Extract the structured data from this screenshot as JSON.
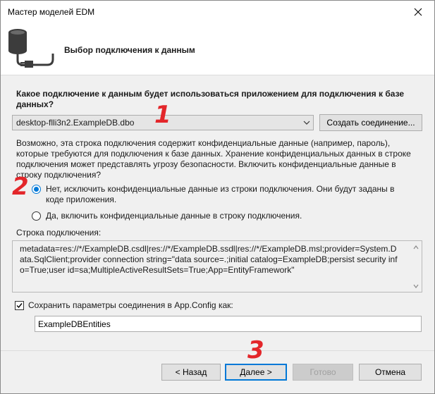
{
  "window": {
    "title": "Мастер моделей EDM"
  },
  "header": {
    "title": "Выбор подключения к данным",
    "icon": "database-plug-icon"
  },
  "question": "Какое подключение к данным будет использоваться приложением для подключения к базе данных?",
  "connection_select": {
    "value": "desktop-flli3n2.ExampleDB.dbo"
  },
  "create_connection_button": "Создать соединение...",
  "warning_text": "Возможно, эта строка подключения содержит конфиденциальные данные (например, пароль), которые требуются для подключения к базе данных. Хранение конфиденциальных данных в строке подключения может представлять угрозу безопасности. Включить конфиденциальные данные в строку подключения?",
  "radio_options": [
    {
      "label": "Нет, исключить конфиденциальные данные из строки подключения. Они будут заданы в коде приложения.",
      "checked": true
    },
    {
      "label": "Да, включить конфиденциальные данные в строку подключения.",
      "checked": false
    }
  ],
  "connection_string_label": "Строка подключения:",
  "connection_string": "metadata=res://*/ExampleDB.csdl|res://*/ExampleDB.ssdl|res://*/ExampleDB.msl;provider=System.Data.SqlClient;provider connection string=\"data source=.;initial catalog=ExampleDB;persist security info=True;user id=sa;MultipleActiveResultSets=True;App=EntityFramework\"",
  "save_settings": {
    "label": "Сохранить параметры соединения в App.Config как:",
    "checked": true
  },
  "entities_name": "ExampleDBEntities",
  "buttons": {
    "back": "< Назад",
    "next": "Далее >",
    "finish": "Готово",
    "cancel": "Отмена"
  },
  "annotations": [
    "1",
    "2",
    "3"
  ],
  "colors": {
    "accent": "#0078d7",
    "annotation": "#e3262a"
  }
}
